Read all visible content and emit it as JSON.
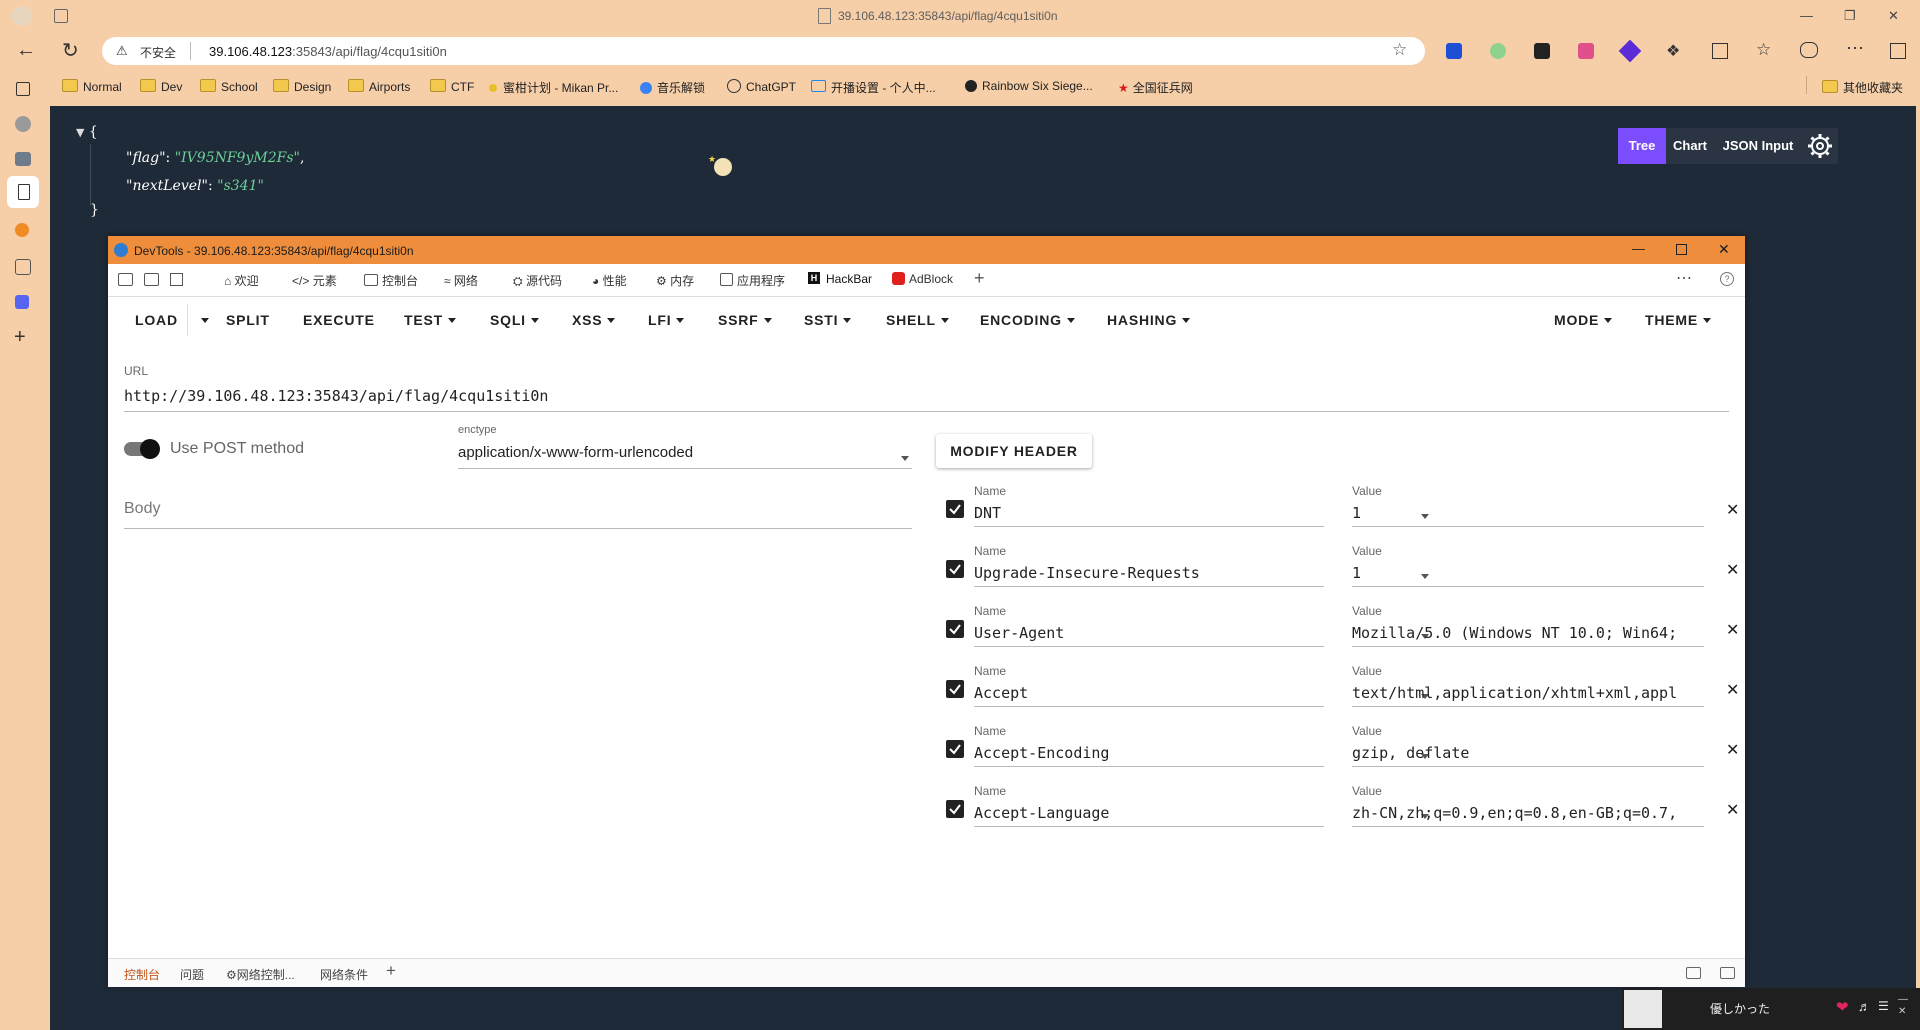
{
  "window": {
    "title": "39.106.48.123:35843/api/flag/4cqu1siti0n"
  },
  "address_bar": {
    "security_label": "不安全",
    "url_host": "39.106.48.123",
    "url_rest": ":35843/api/flag/4cqu1siti0n"
  },
  "bookmarks": {
    "items": [
      {
        "label": "Normal",
        "icon": "folder-icon"
      },
      {
        "label": "Dev",
        "icon": "folder-icon"
      },
      {
        "label": "School",
        "icon": "folder-icon"
      },
      {
        "label": "Design",
        "icon": "folder-icon"
      },
      {
        "label": "Airports",
        "icon": "folder-icon"
      },
      {
        "label": "CTF",
        "icon": "folder-icon"
      },
      {
        "label": "蜜柑计划 - Mikan Pr...",
        "icon": "dot-icon"
      },
      {
        "label": "音乐解锁",
        "icon": "globe-icon"
      },
      {
        "label": "ChatGPT",
        "icon": "openai-icon"
      },
      {
        "label": "开播设置 - 个人中...",
        "icon": "tv-icon"
      },
      {
        "label": "Rainbow Six Siege...",
        "icon": "r6-icon"
      },
      {
        "label": "全国征兵网",
        "icon": "star-icon"
      }
    ],
    "other": "其他收藏夹"
  },
  "json_viewer": {
    "buttons": [
      "Tree",
      "Chart",
      "JSON Input"
    ],
    "open_brace": "{",
    "close_brace": "}",
    "entries": [
      {
        "key": "\"flag\"",
        "value": "\"IV95NF9yM2Fs\"",
        "comma": ","
      },
      {
        "key": "\"nextLevel\"",
        "value": "\"s341\"",
        "comma": ""
      }
    ]
  },
  "devtools": {
    "title": "DevTools - 39.106.48.123:35843/api/flag/4cqu1siti0n",
    "tabs": [
      "欢迎",
      "元素",
      "控制台",
      "网络",
      "源代码",
      "性能",
      "内存",
      "应用程序",
      "HackBar",
      "AdBlock"
    ],
    "bottom_tabs": [
      "控制台",
      "问题",
      "网络控制...",
      "网络条件"
    ]
  },
  "hackbar": {
    "menu": [
      "LOAD",
      "SPLIT",
      "EXECUTE",
      "TEST",
      "SQLI",
      "XSS",
      "LFI",
      "SSRF",
      "SSTI",
      "SHELL",
      "ENCODING",
      "HASHING",
      "MODE",
      "THEME"
    ],
    "url_label": "URL",
    "url_value": "http://39.106.48.123:35843/api/flag/4cqu1siti0n",
    "post_label": "Use POST method",
    "post_enabled": true,
    "enctype_label": "enctype",
    "enctype_value": "application/x-www-form-urlencoded",
    "modify_header": "MODIFY HEADER",
    "body_placeholder": "Body",
    "name_label": "Name",
    "value_label": "Value",
    "headers": [
      {
        "name": "DNT",
        "value": "1",
        "checked": true
      },
      {
        "name": "Upgrade-Insecure-Requests",
        "value": "1",
        "checked": true
      },
      {
        "name": "User-Agent",
        "value": "Mozilla/5.0 (Windows NT 10.0; Win64;",
        "checked": true
      },
      {
        "name": "Accept",
        "value": "text/html,application/xhtml+xml,appl",
        "checked": true
      },
      {
        "name": "Accept-Encoding",
        "value": "gzip, deflate",
        "checked": true
      },
      {
        "name": "Accept-Language",
        "value": "zh-CN,zh;q=0.9,en;q=0.8,en-GB;q=0.7,",
        "checked": true
      }
    ]
  },
  "media": {
    "title": "優しかった"
  },
  "colors": {
    "page_bg": "#1e2a38",
    "devtools_titlebar": "#ee8e3c",
    "json_key": "#ffffff",
    "json_value": "#6fcf97",
    "tree_button": "#7c4dff"
  }
}
